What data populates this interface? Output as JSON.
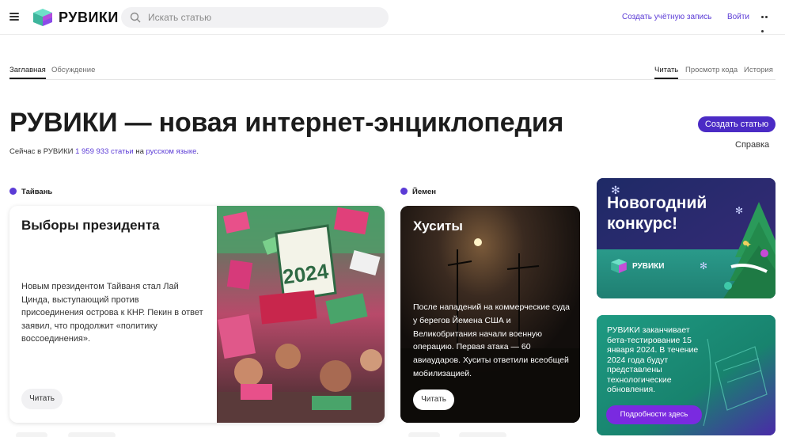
{
  "header": {
    "logo_text": "РУВИКИ",
    "search_placeholder": "Искать статью",
    "create_account": "Создать учётную запись",
    "login": "Войти"
  },
  "tabs": {
    "left": [
      "Заглавная",
      "Обсуждение"
    ],
    "right": [
      "Читать",
      "Просмотр кода",
      "История"
    ]
  },
  "hero": {
    "title": "РУВИКИ — новая интернет-энциклопедия",
    "sub_prefix": "Сейчас в РУВИКИ ",
    "article_count": "1 959 933 статьи",
    "sub_mid": " на ",
    "language_link": "русском языке",
    "sub_suffix": ".",
    "create_article": "Создать статью",
    "help": "Справка"
  },
  "cards": {
    "taiwan": {
      "category": "Тайвань",
      "title": "Выборы президента",
      "text": "Новым президентом Тайваня стал Лай Цинда, выступающий против присоединения острова к КНР. Пекин в ответ заявил, что продолжит «политику воссоединения».",
      "read": "Читать",
      "photo_sign": "2024"
    },
    "yemen": {
      "category": "Йемен",
      "title": "Хуситы",
      "text": "После нападений на коммерческие суда у берегов Йемена США и Великобритания начали военную операцию. Первая атака — 60 авиаударов. Хуситы ответили всеобщей мобилизацией.",
      "read": "Читать"
    },
    "contest": {
      "title_line1": "Новогодний",
      "title_line2": "конкурс!",
      "logo_text": "РУВИКИ"
    },
    "beta": {
      "text": "РУВИКИ заканчивает бета-тестирование 15 января 2024. В течение 2024 года будут представлены технологические обновления.",
      "button": "Подробности здесь"
    }
  },
  "colors": {
    "accent": "#5b3bd6",
    "button": "#4b2bc5",
    "contest_bg": "#1f2f6b",
    "beta_bg": "#15826f",
    "beta_button": "#7a2ae0"
  }
}
